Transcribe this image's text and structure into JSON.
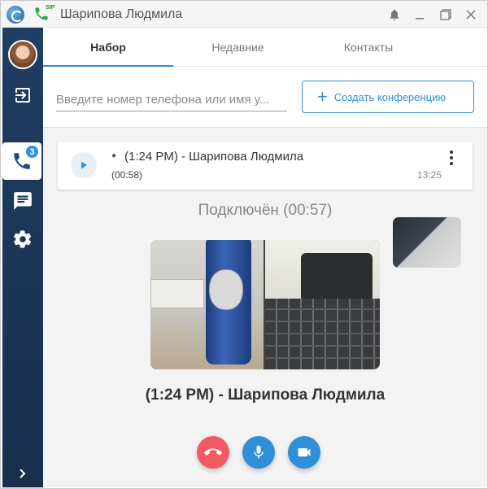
{
  "window": {
    "title": "Шарипова Людмила",
    "sip_label": "SIP"
  },
  "sidebar": {
    "calls_badge": "3"
  },
  "tabs": [
    {
      "label": "Набор",
      "active": true
    },
    {
      "label": "Недавние",
      "active": false
    },
    {
      "label": "Контакты",
      "active": false
    }
  ],
  "search": {
    "placeholder": "Введите номер телефона или имя у...",
    "value": ""
  },
  "conference_button": {
    "label": "Создать конференцию"
  },
  "call_card": {
    "title": "(1:24 PM) - Шарипова Людмила",
    "duration": "(00:58)",
    "time": "13:25"
  },
  "call_status": "Подключён  (00:57)",
  "peer_name": "(1:24 PM) - Шарипова Людмила",
  "colors": {
    "accent": "#2f8fd8",
    "hangup": "#f25a63",
    "sidebar": "#1a3454"
  }
}
